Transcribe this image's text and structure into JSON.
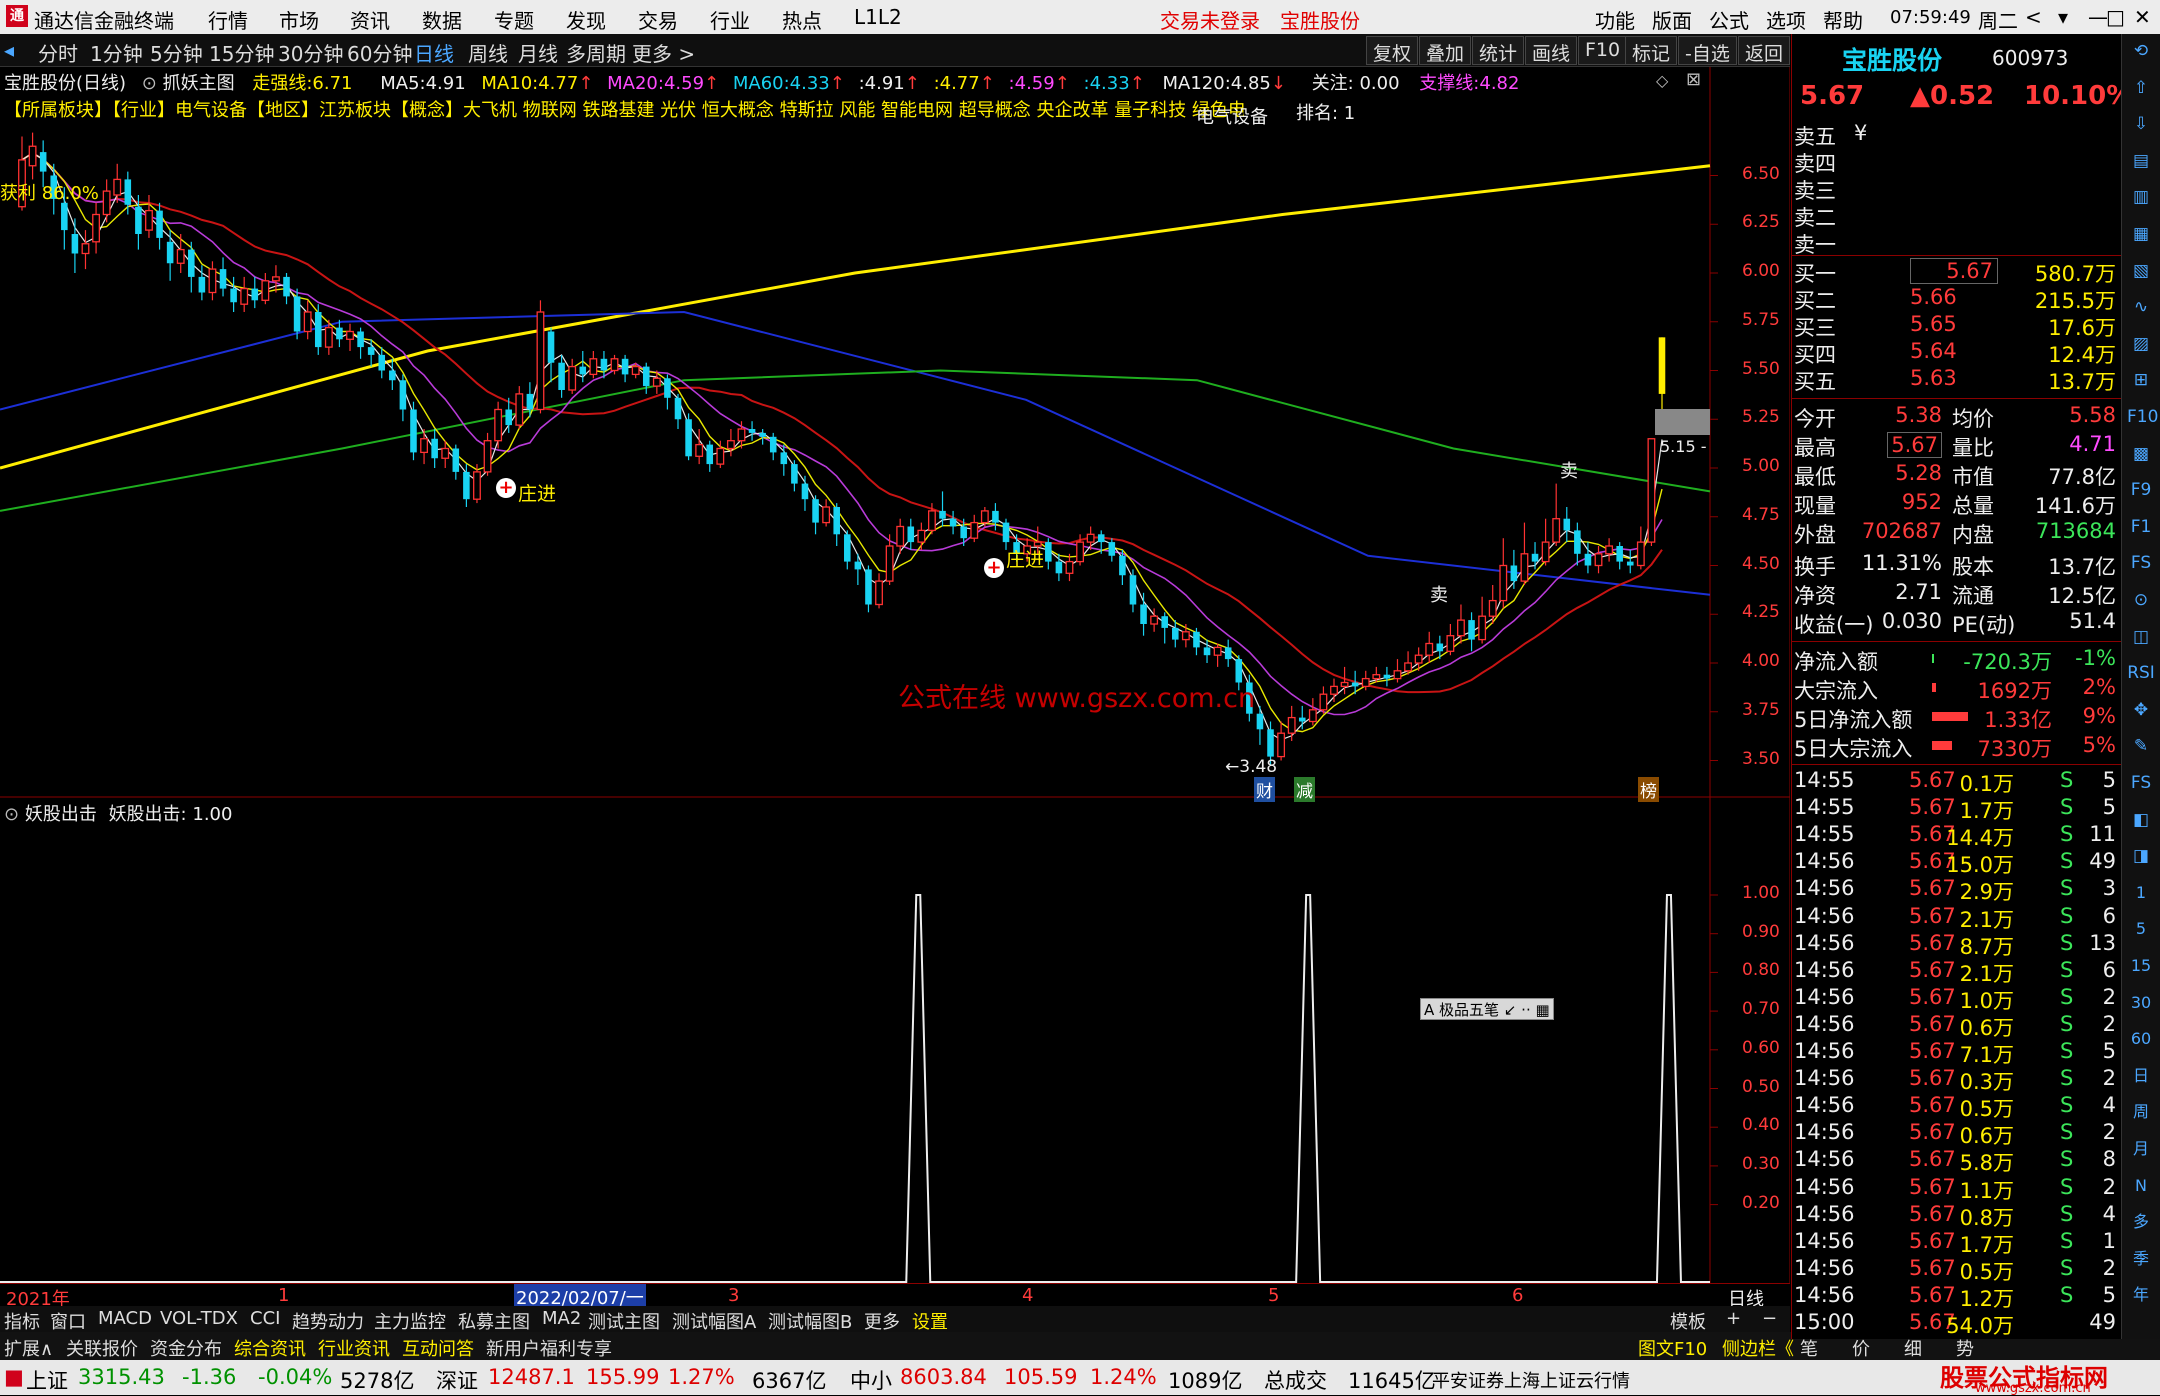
{
  "app": {
    "title": "通达信金融终端",
    "menu": [
      "行情",
      "市场",
      "资讯",
      "数据",
      "专题",
      "发现",
      "交易",
      "行业",
      "热点",
      "L1L2"
    ],
    "status_red": [
      "交易未登录",
      "宝胜股份"
    ],
    "right_menu": [
      "功能",
      "版面",
      "公式",
      "选项",
      "帮助"
    ],
    "clock": "07:59:49",
    "weekday": "周二",
    "win_buttons": [
      "<",
      "▾",
      "—",
      "□",
      "✕"
    ]
  },
  "toolbar": {
    "periods": [
      "分时",
      "1分钟",
      "5分钟",
      "15分钟",
      "30分钟",
      "60分钟",
      "日线",
      "周线",
      "月线",
      "多周期",
      "更多 >"
    ],
    "active": "日线",
    "right_buttons": [
      "复权",
      "叠加",
      "统计",
      "画线",
      "F10",
      "标记",
      "-自选",
      "返回"
    ]
  },
  "chart_header": {
    "name": "宝胜股份(日线)",
    "ind": "抓妖主图",
    "zq_label": "走强线:",
    "zq": "6.71",
    "ma5_label": "MA5:",
    "ma5": "4.91",
    "ma10_label": "MA10:",
    "ma10": "4.77",
    "ma20_label": "MA20:",
    "ma20": "4.59",
    "ma60_label": "MA60:",
    "ma60": "4.33",
    "x1": ":4.91",
    "x2": ":4.77",
    "x3": ":4.59",
    "x4": ":4.33",
    "ma120_label": "MA120:",
    "ma120": "4.85",
    "focus": "关注: 0.00",
    "support_label": "支撑线:",
    "support": "4.82"
  },
  "concept": "【所属板块】【行业】电气设备【地区】江苏板块【概念】大飞机 物联网 铁路基建 光伏 恒大概念 特斯拉 风能 智能电网 超导概念 央企改革 量子科技 绿色电力",
  "concept_overlay": "电气设备",
  "rank": "排名: 1",
  "profit_label": "获利 86.0%",
  "chart_labels": {
    "zhuangjin": "庄进",
    "sell": "卖",
    "low": "3.48",
    "arrow_label": "5.15 -",
    "cai": "财",
    "jian": "减",
    "bang": "榜",
    "watermark": "公式在线 www.gszx.com.cn"
  },
  "price_axis": [
    "6.50",
    "6.25",
    "6.00",
    "5.75",
    "5.50",
    "5.25",
    "5.00",
    "4.75",
    "4.50",
    "4.25",
    "4.00",
    "3.75",
    "3.50"
  ],
  "sub_header": {
    "name": "妖股出击",
    "value_label": "妖股出击:",
    "value": "1.00"
  },
  "sub_axis": [
    "1.00",
    "0.90",
    "0.80",
    "0.70",
    "0.60",
    "0.50",
    "0.40",
    "0.30",
    "0.20"
  ],
  "date_axis": {
    "year": "2021年",
    "d1": "1",
    "date": "2022/02/07/一",
    "m3": "3",
    "m4": "4",
    "m5": "5",
    "m6": "6",
    "period": "日线"
  },
  "mini_toolbar": [
    "A 极品五笔",
    "↙",
    "··",
    "▦"
  ],
  "chart_data": {
    "type": "candlestick",
    "ylim": [
      3.4,
      6.8
    ],
    "candles": [
      [
        6.34,
        6.58,
        6.7,
        6.32
      ],
      [
        6.55,
        6.65,
        6.72,
        6.48
      ],
      [
        6.62,
        6.52,
        6.68,
        6.44
      ],
      [
        6.5,
        6.38,
        6.56,
        6.3
      ],
      [
        6.36,
        6.22,
        6.44,
        6.12
      ],
      [
        6.2,
        6.1,
        6.28,
        6.0
      ],
      [
        6.1,
        6.15,
        6.22,
        6.02
      ],
      [
        6.16,
        6.3,
        6.36,
        6.1
      ],
      [
        6.3,
        6.42,
        6.48,
        6.26
      ],
      [
        6.4,
        6.48,
        6.56,
        6.36
      ],
      [
        6.48,
        6.35,
        6.52,
        6.3
      ],
      [
        6.34,
        6.2,
        6.4,
        6.12
      ],
      [
        6.22,
        6.32,
        6.4,
        6.18
      ],
      [
        6.32,
        6.18,
        6.36,
        6.12
      ],
      [
        6.16,
        6.05,
        6.22,
        5.96
      ],
      [
        6.05,
        6.12,
        6.2,
        6.0
      ],
      [
        6.12,
        5.98,
        6.16,
        5.9
      ],
      [
        5.98,
        5.9,
        6.04,
        5.86
      ],
      [
        5.9,
        6.02,
        6.06,
        5.86
      ],
      [
        6.02,
        5.92,
        6.08,
        5.88
      ],
      [
        5.92,
        5.85,
        5.98,
        5.8
      ],
      [
        5.84,
        5.92,
        5.98,
        5.8
      ],
      [
        5.92,
        5.86,
        5.98,
        5.82
      ],
      [
        5.86,
        5.96,
        6.0,
        5.84
      ],
      [
        5.96,
        5.98,
        6.04,
        5.9
      ],
      [
        5.98,
        5.88,
        6.0,
        5.84
      ],
      [
        5.88,
        5.7,
        5.92,
        5.66
      ],
      [
        5.7,
        5.8,
        5.86,
        5.66
      ],
      [
        5.8,
        5.62,
        5.84,
        5.58
      ],
      [
        5.62,
        5.72,
        5.76,
        5.58
      ],
      [
        5.72,
        5.66,
        5.76,
        5.62
      ],
      [
        5.66,
        5.7,
        5.74,
        5.6
      ],
      [
        5.7,
        5.62,
        5.72,
        5.56
      ],
      [
        5.62,
        5.58,
        5.66,
        5.52
      ],
      [
        5.58,
        5.5,
        5.62,
        5.46
      ],
      [
        5.5,
        5.45,
        5.56,
        5.4
      ],
      [
        5.45,
        5.3,
        5.48,
        5.24
      ],
      [
        5.3,
        5.08,
        5.34,
        5.04
      ],
      [
        5.08,
        5.15,
        5.2,
        5.02
      ],
      [
        5.15,
        5.05,
        5.2,
        5.0
      ],
      [
        5.05,
        5.1,
        5.14,
        5.0
      ],
      [
        5.1,
        4.98,
        5.12,
        4.94
      ],
      [
        4.98,
        4.84,
        5.02,
        4.8
      ],
      [
        4.84,
        4.98,
        5.02,
        4.82
      ],
      [
        4.98,
        5.14,
        5.18,
        4.96
      ],
      [
        5.14,
        5.3,
        5.34,
        5.1
      ],
      [
        5.3,
        5.22,
        5.36,
        5.18
      ],
      [
        5.22,
        5.38,
        5.42,
        5.2
      ],
      [
        5.38,
        5.3,
        5.44,
        5.26
      ],
      [
        5.3,
        5.8,
        5.86,
        5.28
      ],
      [
        5.7,
        5.54,
        5.72,
        5.44
      ],
      [
        5.54,
        5.4,
        5.58,
        5.36
      ],
      [
        5.4,
        5.52,
        5.56,
        5.38
      ],
      [
        5.52,
        5.48,
        5.6,
        5.44
      ],
      [
        5.48,
        5.56,
        5.6,
        5.46
      ],
      [
        5.56,
        5.5,
        5.6,
        5.46
      ],
      [
        5.5,
        5.56,
        5.58,
        5.48
      ],
      [
        5.56,
        5.48,
        5.58,
        5.44
      ],
      [
        5.48,
        5.52,
        5.54,
        5.46
      ],
      [
        5.52,
        5.42,
        5.54,
        5.38
      ],
      [
        5.42,
        5.46,
        5.5,
        5.38
      ],
      [
        5.46,
        5.36,
        5.48,
        5.3
      ],
      [
        5.36,
        5.25,
        5.38,
        5.2
      ],
      [
        5.25,
        5.06,
        5.28,
        5.04
      ],
      [
        5.06,
        5.12,
        5.2,
        5.02
      ],
      [
        5.12,
        5.02,
        5.14,
        4.98
      ],
      [
        5.02,
        5.1,
        5.14,
        5.0
      ],
      [
        5.1,
        5.14,
        5.2,
        5.06
      ],
      [
        5.14,
        5.2,
        5.24,
        5.1
      ],
      [
        5.2,
        5.18,
        5.24,
        5.14
      ],
      [
        5.18,
        5.16,
        5.2,
        5.12
      ],
      [
        5.16,
        5.08,
        5.18,
        5.04
      ],
      [
        5.08,
        5.02,
        5.12,
        4.96
      ],
      [
        5.02,
        4.92,
        5.04,
        4.88
      ],
      [
        4.92,
        4.84,
        4.96,
        4.78
      ],
      [
        4.84,
        4.72,
        4.86,
        4.66
      ],
      [
        4.72,
        4.8,
        4.84,
        4.7
      ],
      [
        4.8,
        4.66,
        4.82,
        4.6
      ],
      [
        4.66,
        4.52,
        4.68,
        4.48
      ],
      [
        4.52,
        4.48,
        4.56,
        4.4
      ],
      [
        4.48,
        4.3,
        4.5,
        4.26
      ],
      [
        4.3,
        4.42,
        4.46,
        4.28
      ],
      [
        4.42,
        4.6,
        4.66,
        4.4
      ],
      [
        4.6,
        4.7,
        4.74,
        4.56
      ],
      [
        4.7,
        4.62,
        4.74,
        4.58
      ],
      [
        4.62,
        4.68,
        4.72,
        4.58
      ],
      [
        4.68,
        4.78,
        4.82,
        4.66
      ],
      [
        4.78,
        4.74,
        4.88,
        4.7
      ],
      [
        4.74,
        4.7,
        4.78,
        4.66
      ],
      [
        4.7,
        4.64,
        4.74,
        4.6
      ],
      [
        4.64,
        4.72,
        4.76,
        4.62
      ],
      [
        4.72,
        4.78,
        4.8,
        4.7
      ],
      [
        4.78,
        4.72,
        4.82,
        4.68
      ],
      [
        4.72,
        4.62,
        4.74,
        4.58
      ],
      [
        4.62,
        4.56,
        4.66,
        4.52
      ],
      [
        4.56,
        4.6,
        4.64,
        4.52
      ],
      [
        4.6,
        4.62,
        4.7,
        4.56
      ],
      [
        4.62,
        4.52,
        4.64,
        4.48
      ],
      [
        4.52,
        4.46,
        4.56,
        4.42
      ],
      [
        4.46,
        4.52,
        4.56,
        4.42
      ],
      [
        4.52,
        4.62,
        4.66,
        4.5
      ],
      [
        4.62,
        4.66,
        4.7,
        4.58
      ],
      [
        4.66,
        4.62,
        4.68,
        4.56
      ],
      [
        4.62,
        4.55,
        4.64,
        4.52
      ],
      [
        4.55,
        4.45,
        4.58,
        4.4
      ],
      [
        4.45,
        4.3,
        4.48,
        4.26
      ],
      [
        4.3,
        4.2,
        4.36,
        4.14
      ],
      [
        4.2,
        4.24,
        4.28,
        4.16
      ],
      [
        4.24,
        4.18,
        4.26,
        4.1
      ],
      [
        4.18,
        4.12,
        4.22,
        4.08
      ],
      [
        4.12,
        4.16,
        4.2,
        4.08
      ],
      [
        4.16,
        4.08,
        4.18,
        4.04
      ],
      [
        4.08,
        4.04,
        4.12,
        4.0
      ],
      [
        4.04,
        4.08,
        4.1,
        3.98
      ],
      [
        4.08,
        4.02,
        4.12,
        3.98
      ],
      [
        4.02,
        3.9,
        4.04,
        3.86
      ],
      [
        3.9,
        3.74,
        3.94,
        3.7
      ],
      [
        3.74,
        3.66,
        3.78,
        3.58
      ],
      [
        3.66,
        3.52,
        3.7,
        3.48
      ],
      [
        3.52,
        3.64,
        3.7,
        3.5
      ],
      [
        3.64,
        3.72,
        3.78,
        3.6
      ],
      [
        3.72,
        3.7,
        3.78,
        3.66
      ],
      [
        3.7,
        3.76,
        3.82,
        3.68
      ],
      [
        3.76,
        3.84,
        3.88,
        3.74
      ],
      [
        3.84,
        3.88,
        3.92,
        3.8
      ],
      [
        3.88,
        3.9,
        3.98,
        3.84
      ],
      [
        3.9,
        3.88,
        3.96,
        3.84
      ],
      [
        3.88,
        3.92,
        3.96,
        3.86
      ],
      [
        3.92,
        3.94,
        3.98,
        3.9
      ],
      [
        3.94,
        3.92,
        3.98,
        3.88
      ],
      [
        3.92,
        3.96,
        4.02,
        3.9
      ],
      [
        3.96,
        4.0,
        4.06,
        3.94
      ],
      [
        4.0,
        4.04,
        4.08,
        3.96
      ],
      [
        4.04,
        4.1,
        4.16,
        4.0
      ],
      [
        4.1,
        4.06,
        4.14,
        4.02
      ],
      [
        4.06,
        4.14,
        4.2,
        4.04
      ],
      [
        4.14,
        4.22,
        4.3,
        4.1
      ],
      [
        4.22,
        4.12,
        4.26,
        4.06
      ],
      [
        4.12,
        4.24,
        4.34,
        4.1
      ],
      [
        4.24,
        4.32,
        4.4,
        4.2
      ],
      [
        4.32,
        4.5,
        4.64,
        4.28
      ],
      [
        4.5,
        4.42,
        4.58,
        4.38
      ],
      [
        4.42,
        4.56,
        4.72,
        4.4
      ],
      [
        4.56,
        4.52,
        4.62,
        4.48
      ],
      [
        4.52,
        4.62,
        4.74,
        4.5
      ],
      [
        4.62,
        4.74,
        4.92,
        4.6
      ],
      [
        4.74,
        4.68,
        4.8,
        4.62
      ],
      [
        4.68,
        4.56,
        4.72,
        4.5
      ],
      [
        4.56,
        4.5,
        4.62,
        4.46
      ],
      [
        4.5,
        4.56,
        4.6,
        4.46
      ],
      [
        4.56,
        4.6,
        4.64,
        4.52
      ],
      [
        4.6,
        4.52,
        4.62,
        4.48
      ],
      [
        4.52,
        4.5,
        4.58,
        4.46
      ],
      [
        4.5,
        4.62,
        4.7,
        4.48
      ],
      [
        4.62,
        5.15,
        5.15,
        4.6
      ],
      [
        5.38,
        5.67,
        5.67,
        5.28
      ]
    ],
    "ma_yellow_long": [
      [
        0,
        5.0
      ],
      [
        0.25,
        5.6
      ],
      [
        0.5,
        6.0
      ],
      [
        0.75,
        6.3
      ],
      [
        1,
        6.55
      ]
    ],
    "ma_blue": [
      [
        0,
        5.3
      ],
      [
        0.2,
        5.75
      ],
      [
        0.4,
        5.8
      ],
      [
        0.6,
        5.35
      ],
      [
        0.8,
        4.55
      ],
      [
        1,
        4.35
      ]
    ],
    "ma_green": [
      [
        0,
        4.78
      ],
      [
        0.2,
        5.1
      ],
      [
        0.4,
        5.45
      ],
      [
        0.55,
        5.5
      ],
      [
        0.7,
        5.45
      ],
      [
        0.85,
        5.1
      ],
      [
        1,
        4.88
      ]
    ],
    "osc_spikes": [
      0.537,
      0.765,
      0.976
    ]
  },
  "right": {
    "stock_name": "宝胜股份",
    "code": "600973",
    "price": "5.67",
    "change": "▲0.52",
    "pct": "10.10%",
    "asks": [
      "卖五",
      "卖四",
      "卖三",
      "卖二",
      "卖一"
    ],
    "ask_marker": "¥",
    "bids": [
      {
        "l": "买一",
        "p": "5.67",
        "v": "580.7万"
      },
      {
        "l": "买二",
        "p": "5.66",
        "v": "215.5万"
      },
      {
        "l": "买三",
        "p": "5.65",
        "v": "17.6万"
      },
      {
        "l": "买四",
        "p": "5.64",
        "v": "12.4万"
      },
      {
        "l": "买五",
        "p": "5.63",
        "v": "13.7万"
      }
    ],
    "stats": [
      [
        "今开",
        "5.38",
        "均价",
        "5.58"
      ],
      [
        "最高",
        "5.67",
        "量比",
        "4.71"
      ],
      [
        "最低",
        "5.28",
        "市值",
        "77.8亿"
      ],
      [
        "现量",
        "952",
        "总量",
        "141.6万"
      ],
      [
        "外盘",
        "702687",
        "内盘",
        "713684"
      ],
      [
        "换手",
        "11.31%",
        "股本",
        "13.7亿"
      ],
      [
        "净资",
        "2.71",
        "流通",
        "12.5亿"
      ],
      [
        "收益(一)",
        "0.030",
        "PE(动)",
        "51.4"
      ]
    ],
    "flows": [
      [
        "净流入额",
        "-720.3万",
        "-1%"
      ],
      [
        "大宗流入",
        "1692万",
        "2%"
      ],
      [
        "5日净流入额",
        "1.33亿",
        "9%"
      ],
      [
        "5日大宗流入",
        "7330万",
        "5%"
      ]
    ],
    "ticks": [
      [
        "14:55",
        "5.67",
        "0.1万",
        "S",
        "5"
      ],
      [
        "14:55",
        "5.67",
        "1.7万",
        "S",
        "5"
      ],
      [
        "14:55",
        "5.67",
        "14.4万",
        "S",
        "11"
      ],
      [
        "14:56",
        "5.67",
        "15.0万",
        "S",
        "49"
      ],
      [
        "14:56",
        "5.67",
        "2.9万",
        "S",
        "3"
      ],
      [
        "14:56",
        "5.67",
        "2.1万",
        "S",
        "6"
      ],
      [
        "14:56",
        "5.67",
        "8.7万",
        "S",
        "13"
      ],
      [
        "14:56",
        "5.67",
        "2.1万",
        "S",
        "6"
      ],
      [
        "14:56",
        "5.67",
        "1.0万",
        "S",
        "2"
      ],
      [
        "14:56",
        "5.67",
        "0.6万",
        "S",
        "2"
      ],
      [
        "14:56",
        "5.67",
        "7.1万",
        "S",
        "5"
      ],
      [
        "14:56",
        "5.67",
        "0.3万",
        "S",
        "2"
      ],
      [
        "14:56",
        "5.67",
        "0.5万",
        "S",
        "4"
      ],
      [
        "14:56",
        "5.67",
        "0.6万",
        "S",
        "2"
      ],
      [
        "14:56",
        "5.67",
        "5.8万",
        "S",
        "8"
      ],
      [
        "14:56",
        "5.67",
        "1.1万",
        "S",
        "2"
      ],
      [
        "14:56",
        "5.67",
        "0.8万",
        "S",
        "4"
      ],
      [
        "14:56",
        "5.67",
        "1.7万",
        "S",
        "1"
      ],
      [
        "14:56",
        "5.67",
        "0.5万",
        "S",
        "2"
      ],
      [
        "14:56",
        "5.67",
        "1.2万",
        "S",
        "5"
      ],
      [
        "15:00",
        "5.67",
        "54.0万",
        "",
        "49"
      ]
    ],
    "bottom_tabs": [
      "笔",
      "价",
      "细",
      "势"
    ]
  },
  "sidebar_icons": [
    "⟲",
    "⇧",
    "⇩",
    "▤",
    "▥",
    "▦",
    "▧",
    "∿",
    "▨",
    "⊞",
    "F10",
    "▩",
    "F9",
    "F1",
    "FS",
    "⊙",
    "◫",
    "RSI",
    "✥",
    "✎",
    "FS",
    "◧",
    "◨",
    "1",
    "5",
    "15",
    "30",
    "60",
    "日",
    "周",
    "月",
    "N",
    "多",
    "季",
    "年"
  ],
  "bottom_tabs": [
    "指标",
    "窗口",
    "MACD",
    "VOL-TDX",
    "CCI",
    "趋势动力",
    "主力监控",
    "私募主图",
    "MA2",
    "测试主图",
    "测试幅图A",
    "测试幅图B",
    "更多",
    "设置"
  ],
  "bottom_right": [
    "模板",
    "+",
    "−"
  ],
  "footer2": {
    "items": [
      "扩展∧",
      "关联报价",
      "资金分布",
      "综合资讯",
      "行业资讯",
      "互动问答",
      "新用户福利专享"
    ],
    "right": [
      "图文F10",
      "侧边栏《"
    ]
  },
  "statusbar": {
    "sh_label": "上证",
    "sh": "3315.43",
    "sh_chg": "-1.36",
    "sh_pct": "-0.04%",
    "sh_amt": "5278亿",
    "sz_label": "深证",
    "sz": "12487.1",
    "sz_chg": "155.99",
    "sz_pct": "1.27%",
    "sz_amt": "6367亿",
    "zx_label": "中小",
    "zx": "8603.84",
    "zx_chg": "105.59",
    "zx_pct": "1.24%",
    "zx_amt": "1089亿",
    "total_label": "总成交",
    "total": "11645亿",
    "source": "平安证券上海上证云行情",
    "brand": "股票公式指标网",
    "brand_url": "www.gszx.com.cn"
  }
}
